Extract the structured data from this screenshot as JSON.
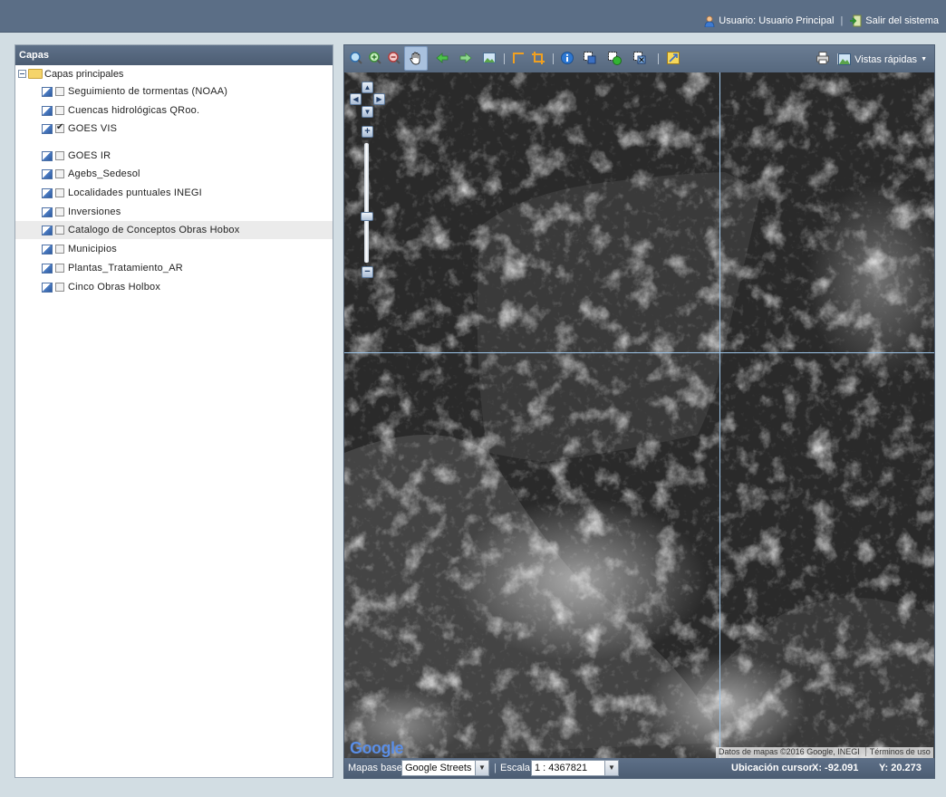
{
  "header": {
    "user_label": "Usuario: Usuario Principal",
    "logout_label": "Salir del sistema"
  },
  "layers_panel": {
    "title": "Capas",
    "root_label": "Capas principales",
    "layers": [
      {
        "label": "Seguimiento de tormentas (NOAA)",
        "checked": false
      },
      {
        "label": "Cuencas hidrológicas QRoo.",
        "checked": false
      },
      {
        "label": "GOES VIS",
        "checked": true
      },
      {
        "label": "GOES IR",
        "checked": false
      },
      {
        "label": "Agebs_Sedesol",
        "checked": false
      },
      {
        "label": "Localidades puntuales INEGI",
        "checked": false
      },
      {
        "label": "Inversiones",
        "checked": false
      },
      {
        "label": "Catalogo de Conceptos Obras Hobox",
        "checked": false
      },
      {
        "label": "Municipios",
        "checked": false
      },
      {
        "label": "Plantas_Tratamiento_AR",
        "checked": false
      },
      {
        "label": "Cinco Obras Holbox",
        "checked": false
      }
    ]
  },
  "toolbar": {
    "tools": [
      "zoom-extent-icon",
      "zoom-in-icon",
      "zoom-out-icon",
      "pan-hand-icon",
      "back-arrow-icon",
      "forward-arrow-icon",
      "map-image-icon",
      "measure-line-icon",
      "measure-area-icon",
      "info-icon",
      "select-box-icon",
      "select-add-icon",
      "select-clear-icon",
      "export-icon",
      "print-icon"
    ],
    "active_tool": "pan-hand-icon",
    "vistas_label": "Vistas rápidas"
  },
  "map": {
    "google_logo": "Google",
    "attribution": "Datos de mapas ©2016 Google, INEGI",
    "terms": "Términos de uso"
  },
  "footer": {
    "basemap_label": "Mapas base",
    "basemap_value": "Google Streets",
    "scale_label": "Escala",
    "scale_value": "1 : 4367821",
    "cursor_label": "Ubicación cursor",
    "cursor_x": "X: -92.091",
    "cursor_y": "Y: 20.273"
  },
  "colors": {
    "header_bg": "#5b6e86",
    "page_bg": "#d2dde3",
    "crosshair": "#9cc4e8",
    "highlight_row": "#ebebeb"
  }
}
